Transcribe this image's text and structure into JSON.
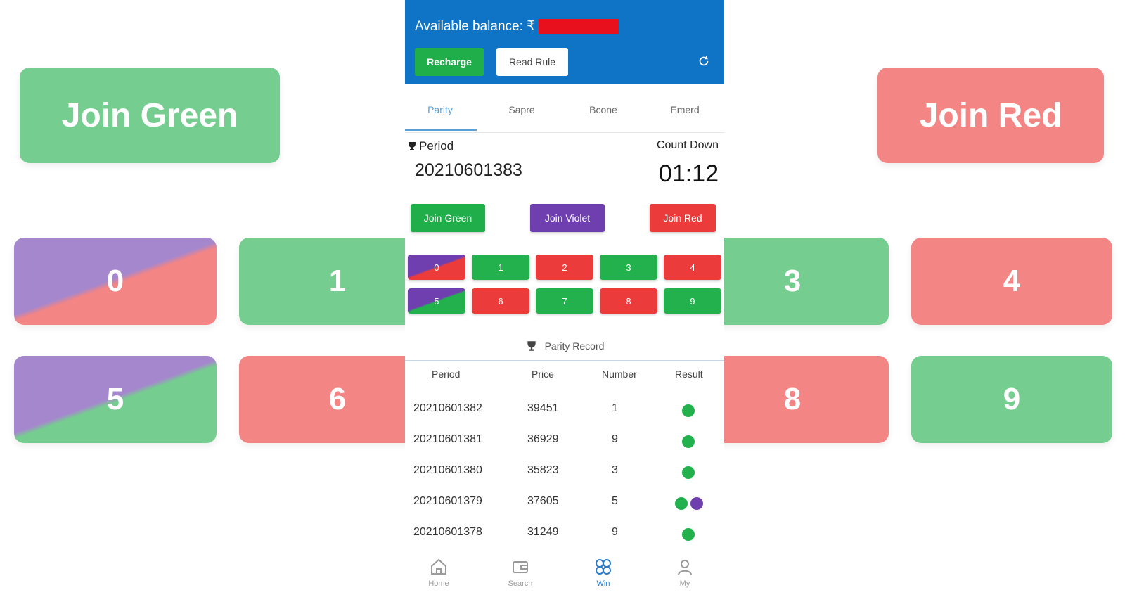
{
  "background": {
    "join_green": "Join Green",
    "join_red": "Join Red",
    "tiles": [
      "0",
      "1",
      "3",
      "4",
      "5",
      "6",
      "8",
      "9"
    ]
  },
  "header": {
    "balance_label": "Available balance: ₹",
    "recharge": "Recharge",
    "read_rule": "Read Rule"
  },
  "tabs": [
    "Parity",
    "Sapre",
    "Bcone",
    "Emerd"
  ],
  "game": {
    "period_label": "Period",
    "period_value": "20210601383",
    "countdown_label": "Count Down",
    "countdown_value": "01:12",
    "join_green": "Join Green",
    "join_violet": "Join Violet",
    "join_red": "Join Red",
    "numbers": [
      {
        "n": "0",
        "color": "violet-red"
      },
      {
        "n": "1",
        "color": "green"
      },
      {
        "n": "2",
        "color": "red"
      },
      {
        "n": "3",
        "color": "green"
      },
      {
        "n": "4",
        "color": "red"
      },
      {
        "n": "5",
        "color": "violet-green"
      },
      {
        "n": "6",
        "color": "red"
      },
      {
        "n": "7",
        "color": "green"
      },
      {
        "n": "8",
        "color": "red"
      },
      {
        "n": "9",
        "color": "green"
      }
    ]
  },
  "record": {
    "title": "Parity Record",
    "headers": [
      "Period",
      "Price",
      "Number",
      "Result"
    ],
    "rows": [
      {
        "period": "20210601382",
        "price": "39451",
        "number": "1",
        "result": [
          "green"
        ]
      },
      {
        "period": "20210601381",
        "price": "36929",
        "number": "9",
        "result": [
          "green"
        ]
      },
      {
        "period": "20210601380",
        "price": "35823",
        "number": "3",
        "result": [
          "green"
        ]
      },
      {
        "period": "20210601379",
        "price": "37605",
        "number": "5",
        "result": [
          "green",
          "violet"
        ]
      },
      {
        "period": "20210601378",
        "price": "31249",
        "number": "9",
        "result": [
          "green"
        ]
      }
    ]
  },
  "nav": [
    "Home",
    "Search",
    "Win",
    "My"
  ],
  "colors": {
    "header_blue": "#0f74c6",
    "green": "#22b14c",
    "red": "#ec3b3b",
    "violet": "#6f3fb0",
    "redaction": "#e8101c"
  }
}
